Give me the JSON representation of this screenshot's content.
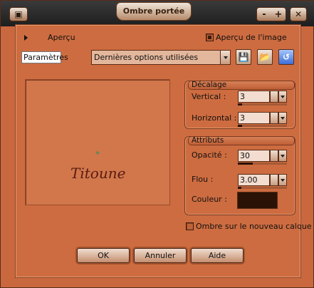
{
  "window": {
    "title": "Ombre portée",
    "minimize_label": "-",
    "maximize_label": "+",
    "close_label": "✕"
  },
  "preview_toggle": {
    "label": "Aperçu"
  },
  "image_preview": {
    "label": "Aperçu de l'image",
    "checked": true
  },
  "presets": {
    "label": "Paramètres",
    "selected": "Dernières options utilisées"
  },
  "preview": {
    "signature": "Titoune",
    "marker": "⌖"
  },
  "offset_group": {
    "title": "Décalage",
    "vertical": {
      "label": "Vertical :",
      "value": "3"
    },
    "horizontal": {
      "label": "Horizontal :",
      "value": "3"
    }
  },
  "attributes_group": {
    "title": "Attributs",
    "opacity": {
      "label": "Opacité :",
      "value": "30"
    },
    "blur": {
      "label": "Flou :",
      "value": "3.00"
    },
    "color": {
      "label": "Couleur :",
      "value": "#2b1206"
    }
  },
  "new_layer": {
    "label": "Ombre sur le nouveau calque",
    "checked": false
  },
  "buttons": {
    "ok": "OK",
    "cancel": "Annuler",
    "help": "Aide"
  },
  "colors": {
    "window_bg": "#c9683e",
    "titlebar": "#1e1e1e",
    "shadow_color": "#2b1206"
  }
}
